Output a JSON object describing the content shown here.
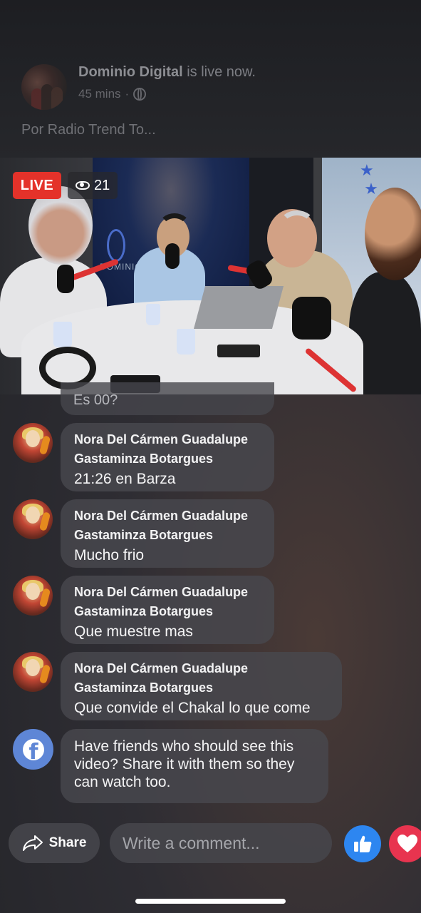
{
  "header": {
    "page_name": "Dominio Digital",
    "status": " is live now.",
    "time": "45 mins",
    "separator": "·",
    "privacy_icon": "globe-icon",
    "description": "Por Radio Trend To..."
  },
  "video": {
    "live_label": "LIVE",
    "viewer_count": "21",
    "viewer_icon": "eye-icon",
    "screen_text": "DOMINIO DIGITAL"
  },
  "comments": {
    "peek_text": "Es 00?",
    "items": [
      {
        "author_line1": "Nora Del Cármen Guadalupe",
        "author_line2": "Gastaminza Botargues",
        "text": "21:26 en Barza"
      },
      {
        "author_line1": "Nora Del Cármen Guadalupe",
        "author_line2": "Gastaminza Botargues",
        "text": "Mucho frio"
      },
      {
        "author_line1": "Nora Del Cármen Guadalupe",
        "author_line2": "Gastaminza Botargues",
        "text": "Que muestre mas"
      },
      {
        "author_line1": "Nora Del Cármen Guadalupe",
        "author_line2": "Gastaminza Botargues",
        "text": "Que convide el Chakal lo que come"
      }
    ],
    "system_message": "Have friends who should see this video? Share it with them so they can watch too."
  },
  "actions": {
    "share_label": "Share",
    "comment_placeholder": "Write a comment...",
    "like_icon": "thumbs-up-icon",
    "love_icon": "heart-icon"
  },
  "colors": {
    "live_red": "#e4322a",
    "like_blue": "#2d86f0",
    "love_red": "#e8344f",
    "facebook_blue": "#5e86d6"
  }
}
